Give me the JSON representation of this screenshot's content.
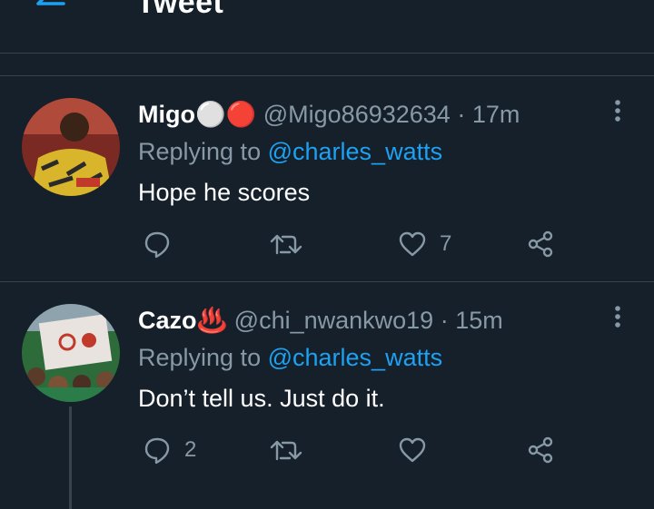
{
  "header": {
    "title": "Tweet"
  },
  "tweets": [
    {
      "name": "Migo",
      "emoji": "⚪🔴",
      "handle": "@Migo86932634",
      "time": "17m",
      "replying_prefix": "Replying to",
      "replying_to": "@charles_watts",
      "text": "Hope he scores",
      "replies": "",
      "retweets": "",
      "likes": "7"
    },
    {
      "name": "Cazo",
      "emoji": "♨️",
      "handle": "@chi_nwankwo19",
      "time": "15m",
      "replying_prefix": "Replying to",
      "replying_to": "@charles_watts",
      "text": "Don’t tell us. Just do it.",
      "replies": "2",
      "retweets": "",
      "likes": ""
    }
  ],
  "colors": {
    "background": "#15202b",
    "accent": "#1da1f2",
    "muted": "#8899a6",
    "divider": "#38444d"
  }
}
